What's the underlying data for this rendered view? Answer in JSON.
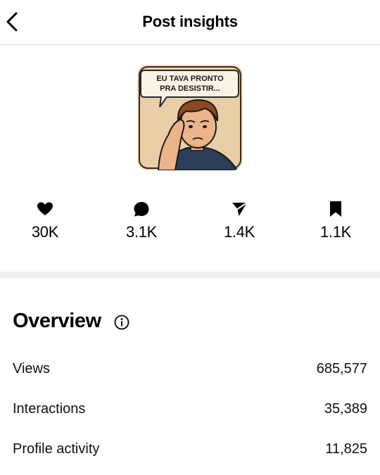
{
  "header": {
    "title": "Post insights",
    "back_icon": "chevron-left-icon"
  },
  "post": {
    "thumbnail_caption": [
      "EU TAVA PRONTO",
      "PRA DESISTIR..."
    ]
  },
  "stats": [
    {
      "icon": "heart-icon",
      "label": "30K"
    },
    {
      "icon": "comment-icon",
      "label": "3.1K"
    },
    {
      "icon": "share-icon",
      "label": "1.4K"
    },
    {
      "icon": "bookmark-icon",
      "label": "1.1K"
    }
  ],
  "overview": {
    "title": "Overview",
    "info_icon": "info-icon",
    "rows": [
      {
        "label": "Views",
        "value": "685,577"
      },
      {
        "label": "Interactions",
        "value": "35,389"
      },
      {
        "label": "Profile activity",
        "value": "11,825"
      }
    ]
  },
  "colors": {
    "background": "#ffffff",
    "text": "#000000",
    "divider": "#efefef"
  }
}
